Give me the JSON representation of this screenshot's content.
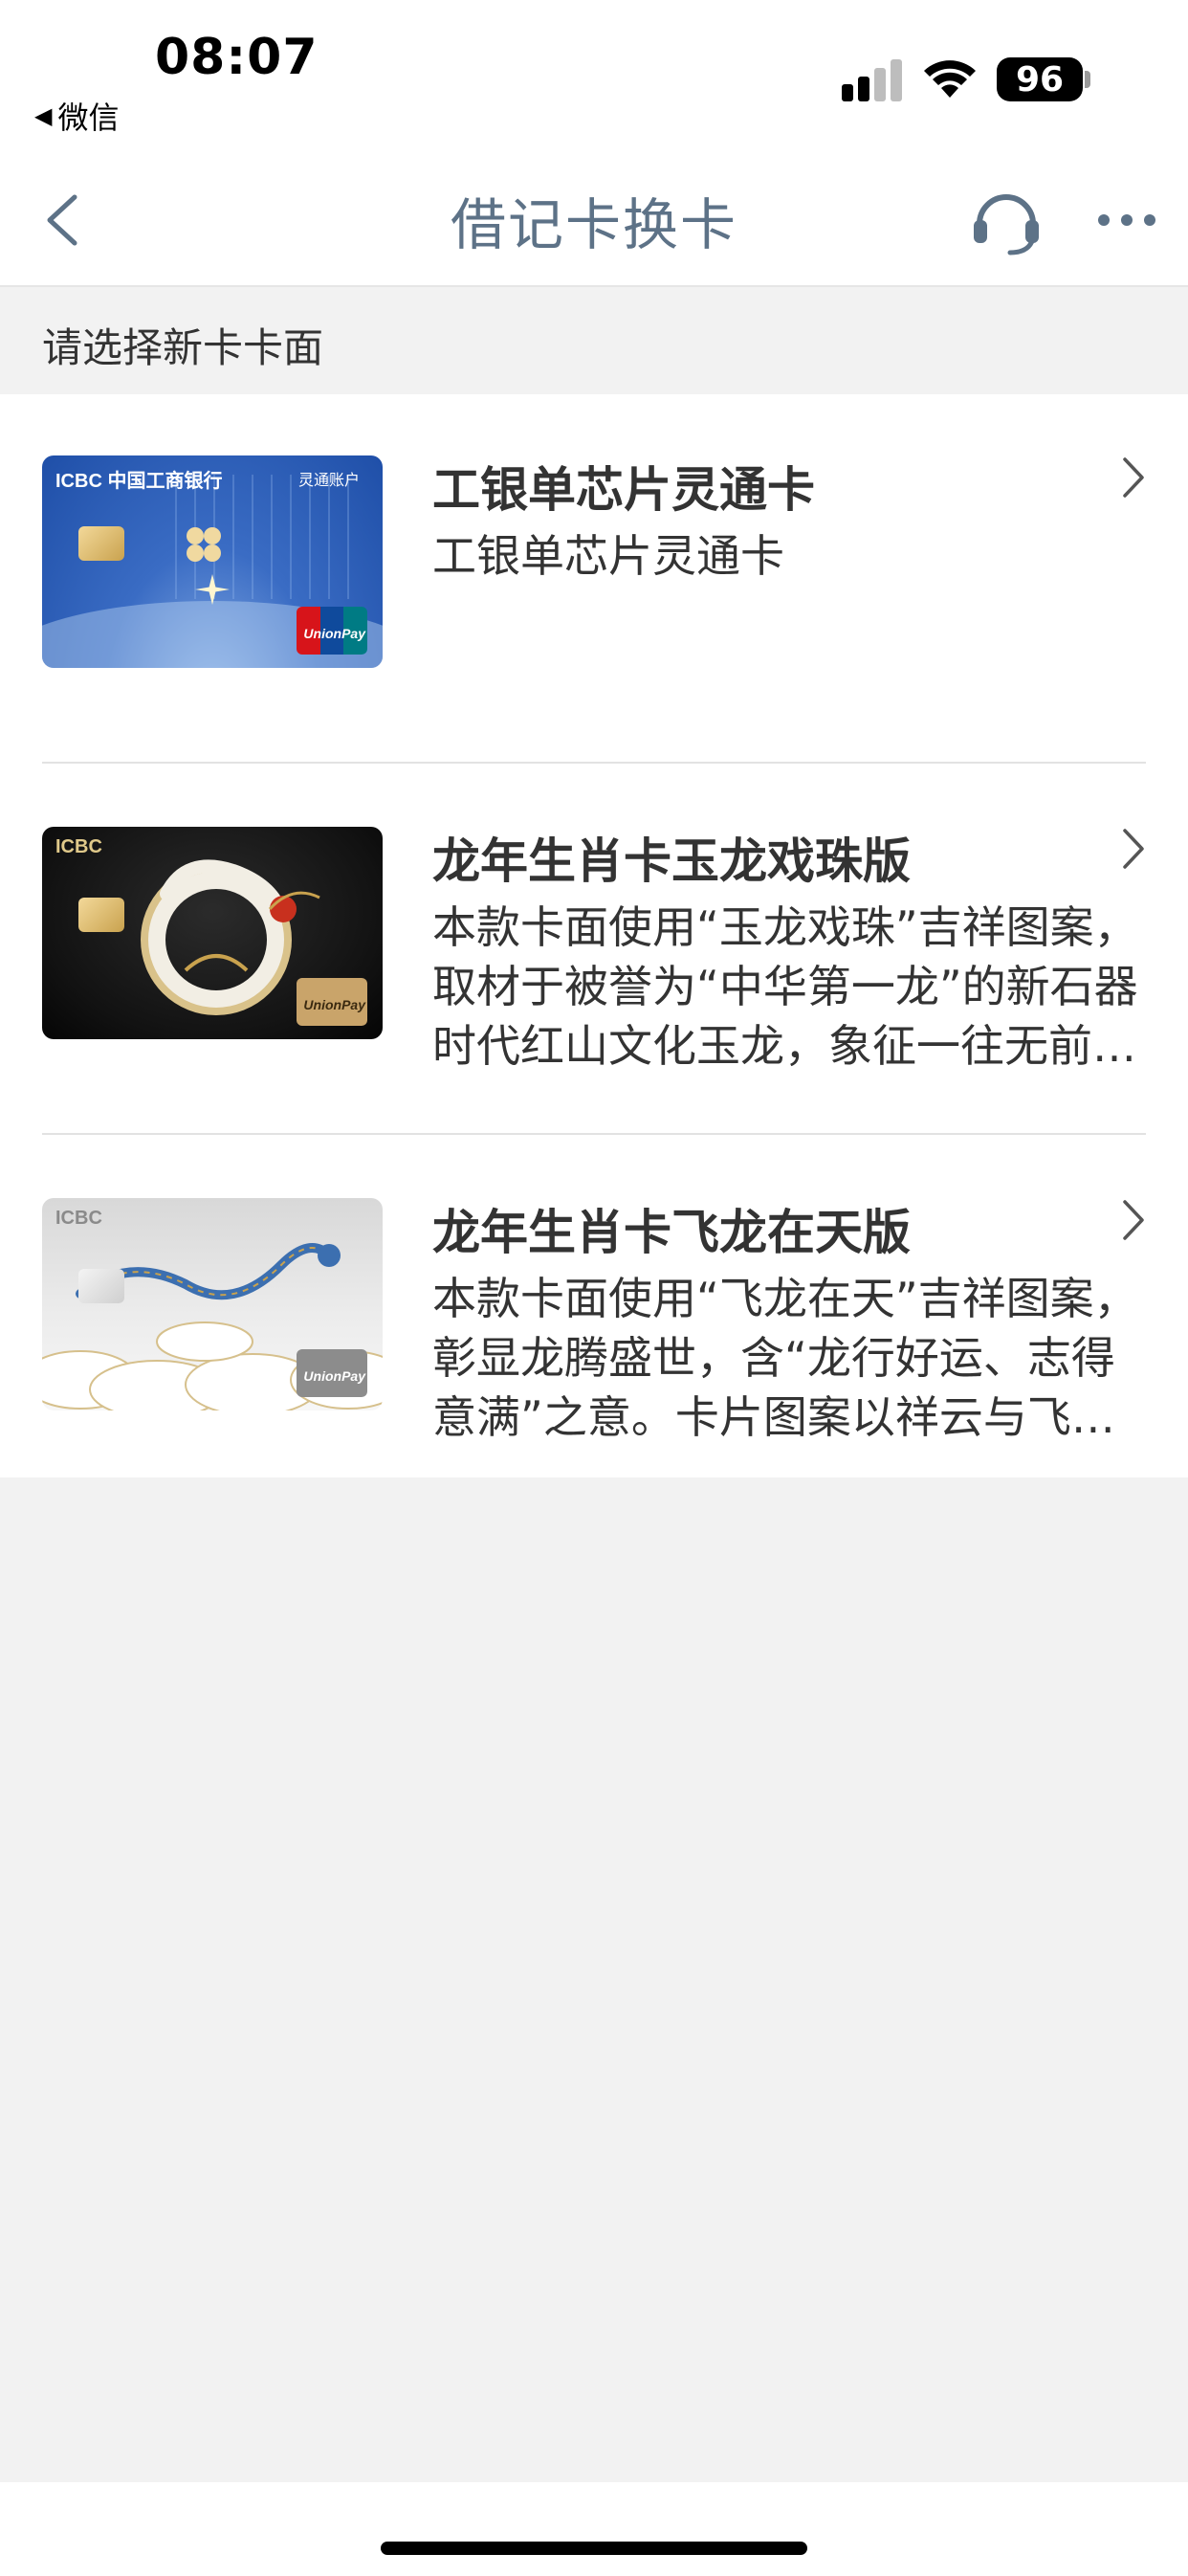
{
  "status_bar": {
    "time": "08:07",
    "back_app": "微信",
    "battery": "96"
  },
  "nav": {
    "title": "借记卡换卡",
    "back_icon": "chevron-left-icon",
    "service_icon": "headset-icon",
    "more_icon": "more-horizontal-icon"
  },
  "section": {
    "label": "请选择新卡卡面"
  },
  "cards": [
    {
      "title": "工银单芯片灵通卡",
      "description": "工银单芯片灵通卡",
      "art": {
        "theme": "blue",
        "brand": "ICBC 中国工商银行",
        "corner": "灵通账户"
      }
    },
    {
      "title": "龙年生肖卡玉龙戏珠版",
      "description": "本款卡面使用“玉龙戏珠”吉祥图案，取材于被誉为“中华第一龙”的新石器时代红山文化玉龙，象征一往无前、蓬勃向上的奋斗精神。",
      "art": {
        "theme": "black",
        "brand": "ICBC"
      }
    },
    {
      "title": "龙年生肖卡飞龙在天版",
      "description": "本款卡面使用“飞龙在天”吉祥图案，彰显龙腾盛世，含“龙行好运、志得意满”之意。卡片图案以祥云与飞龙相映成趣。",
      "art": {
        "theme": "white",
        "brand": "ICBC"
      }
    }
  ],
  "unionpay_label": "UnionPay",
  "colors": {
    "nav_title": "#5d7287",
    "page_bg": "#f2f2f2"
  }
}
